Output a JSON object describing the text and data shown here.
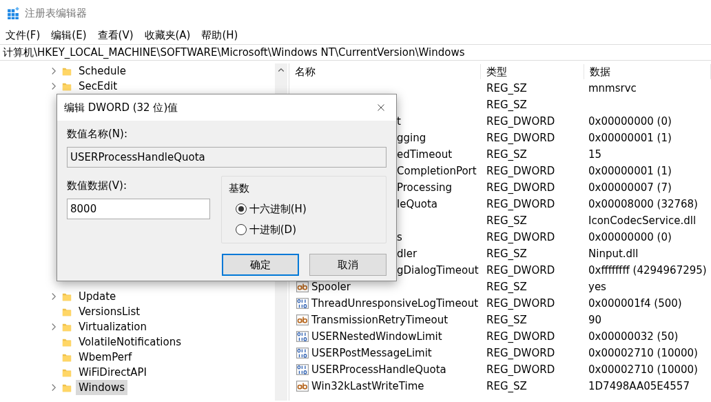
{
  "window": {
    "title": "注册表编辑器"
  },
  "menu": [
    "文件(F)",
    "编辑(E)",
    "查看(V)",
    "收藏夹(A)",
    "帮助(H)"
  ],
  "address": "计算机\\HKEY_LOCAL_MACHINE\\SOFTWARE\\Microsoft\\Windows NT\\CurrentVersion\\Windows",
  "tree": {
    "top": [
      {
        "label": "Schedule",
        "expandable": true,
        "selected": false
      },
      {
        "label": "SecEdit",
        "expandable": true,
        "selected": false
      }
    ],
    "bottom": [
      {
        "label": "Update",
        "expandable": true,
        "selected": false
      },
      {
        "label": "VersionsList",
        "expandable": false,
        "selected": false
      },
      {
        "label": "Virtualization",
        "expandable": true,
        "selected": false
      },
      {
        "label": "VolatileNotifications",
        "expandable": false,
        "selected": false
      },
      {
        "label": "WbemPerf",
        "expandable": false,
        "selected": false
      },
      {
        "label": "WiFiDirectAPI",
        "expandable": false,
        "selected": false
      },
      {
        "label": "Windows",
        "expandable": true,
        "selected": true
      }
    ]
  },
  "list": {
    "columns": [
      "名称",
      "类型",
      "数据"
    ],
    "rows": [
      {
        "type": "REG_SZ",
        "data": "mnmsrvc"
      },
      {
        "type": "REG_SZ"
      },
      {
        "clipped": true,
        "name": "t",
        "type": "REG_DWORD",
        "data": "0x00000000 (0)"
      },
      {
        "clipped": true,
        "name": "gging",
        "type": "REG_DWORD",
        "data": "0x00000001 (1)"
      },
      {
        "clipped": true,
        "name": "edTimeout",
        "type": "REG_SZ",
        "data": "15"
      },
      {
        "clipped": true,
        "name": "CompletionPort",
        "type": "REG_DWORD",
        "data": "0x00000001 (1)"
      },
      {
        "clipped": true,
        "name": "Processing",
        "type": "REG_DWORD",
        "data": "0x00000007 (7)"
      },
      {
        "clipped": true,
        "name": "leQuota",
        "type": "REG_DWORD",
        "data": "0x00008000 (32768)"
      },
      {
        "type": "REG_SZ",
        "data": "IconCodecService.dll"
      },
      {
        "clipped": true,
        "name": "s",
        "type": "REG_DWORD",
        "data": "0x00000000 (0)"
      },
      {
        "clipped": true,
        "name": "dler",
        "type": "REG_SZ",
        "data": "Ninput.dll"
      },
      {
        "clipped": true,
        "name": "gDialogTimeout",
        "type": "REG_DWORD",
        "data": "0xffffffff (4294967295)"
      },
      {
        "clipped": false,
        "kind": "sz",
        "name": "Spooler",
        "type": "REG_SZ",
        "data": "yes"
      },
      {
        "clipped": false,
        "kind": "dword",
        "name": "ThreadUnresponsiveLogTimeout",
        "type": "REG_DWORD",
        "data": "0x000001f4 (500)"
      },
      {
        "clipped": false,
        "kind": "sz",
        "name": "TransmissionRetryTimeout",
        "type": "REG_SZ",
        "data": "90"
      },
      {
        "clipped": false,
        "kind": "dword",
        "name": "USERNestedWindowLimit",
        "type": "REG_DWORD",
        "data": "0x00000032 (50)"
      },
      {
        "clipped": false,
        "kind": "dword",
        "name": "USERPostMessageLimit",
        "type": "REG_DWORD",
        "data": "0x00002710 (10000)"
      },
      {
        "clipped": false,
        "kind": "dword",
        "name": "USERProcessHandleQuota",
        "type": "REG_DWORD",
        "data": "0x00002710 (10000)"
      },
      {
        "clipped": false,
        "kind": "sz",
        "name": "Win32kLastWriteTime",
        "type": "REG_SZ",
        "data": "1D7498AA05E4557"
      }
    ]
  },
  "dialog": {
    "title": "编辑 DWORD (32 位)值",
    "name_label": "数值名称(N):",
    "name_value": "USERProcessHandleQuota",
    "data_label": "数值数据(V):",
    "data_value": "8000",
    "base_label": "基数",
    "bases": [
      {
        "label": "十六进制(H)",
        "selected": true
      },
      {
        "label": "十进制(D)",
        "selected": false
      }
    ],
    "buttons": [
      {
        "label": "确定",
        "default": true
      },
      {
        "label": "取消",
        "default": false
      }
    ]
  }
}
